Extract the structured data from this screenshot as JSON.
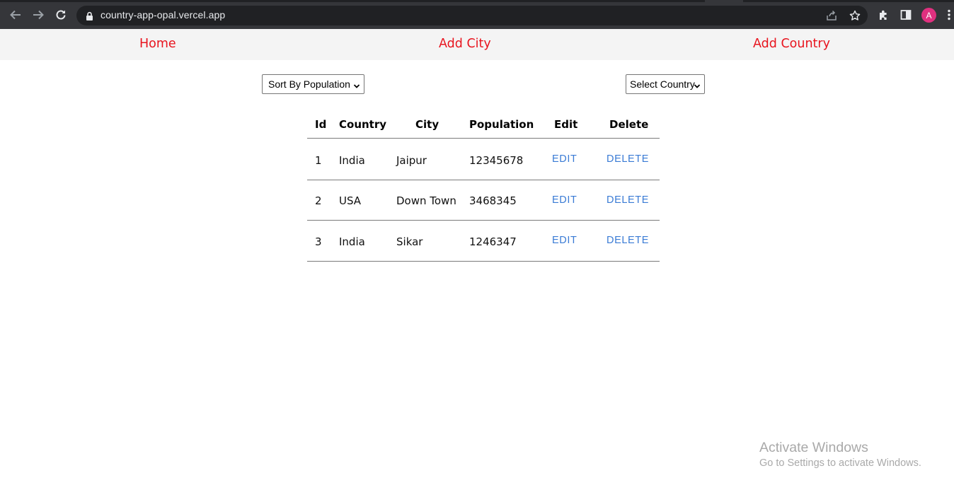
{
  "browser": {
    "url": "country-app-opal.vercel.app",
    "avatar_letter": "A",
    "icons": [
      "back-arrow-icon",
      "forward-arrow-icon",
      "reload-icon",
      "lock-icon",
      "share-icon",
      "star-icon",
      "extensions-icon",
      "side-panel-icon",
      "more-vert-icon"
    ]
  },
  "nav": {
    "home": "Home",
    "add_city": "Add City",
    "add_country": "Add Country",
    "link_color": "#e8141e"
  },
  "controls": {
    "sort_select": "Sort By Population",
    "country_select": "Select Country"
  },
  "table": {
    "headers": [
      "Id",
      "Country",
      "City",
      "Population",
      "Edit",
      "Delete"
    ],
    "rows": [
      {
        "id": "1",
        "country": "India",
        "city": "Jaipur",
        "population": "12345678",
        "edit": "EDIT",
        "delete": "DELETE"
      },
      {
        "id": "2",
        "country": "USA",
        "city": "Down Town",
        "population": "3468345",
        "edit": "EDIT",
        "delete": "DELETE"
      },
      {
        "id": "3",
        "country": "India",
        "city": "Sikar",
        "population": "1246347",
        "edit": "EDIT",
        "delete": "DELETE"
      }
    ],
    "action_color": "#3a7bd5"
  },
  "watermark": {
    "title": "Activate Windows",
    "subtitle": "Go to Settings to activate Windows."
  }
}
